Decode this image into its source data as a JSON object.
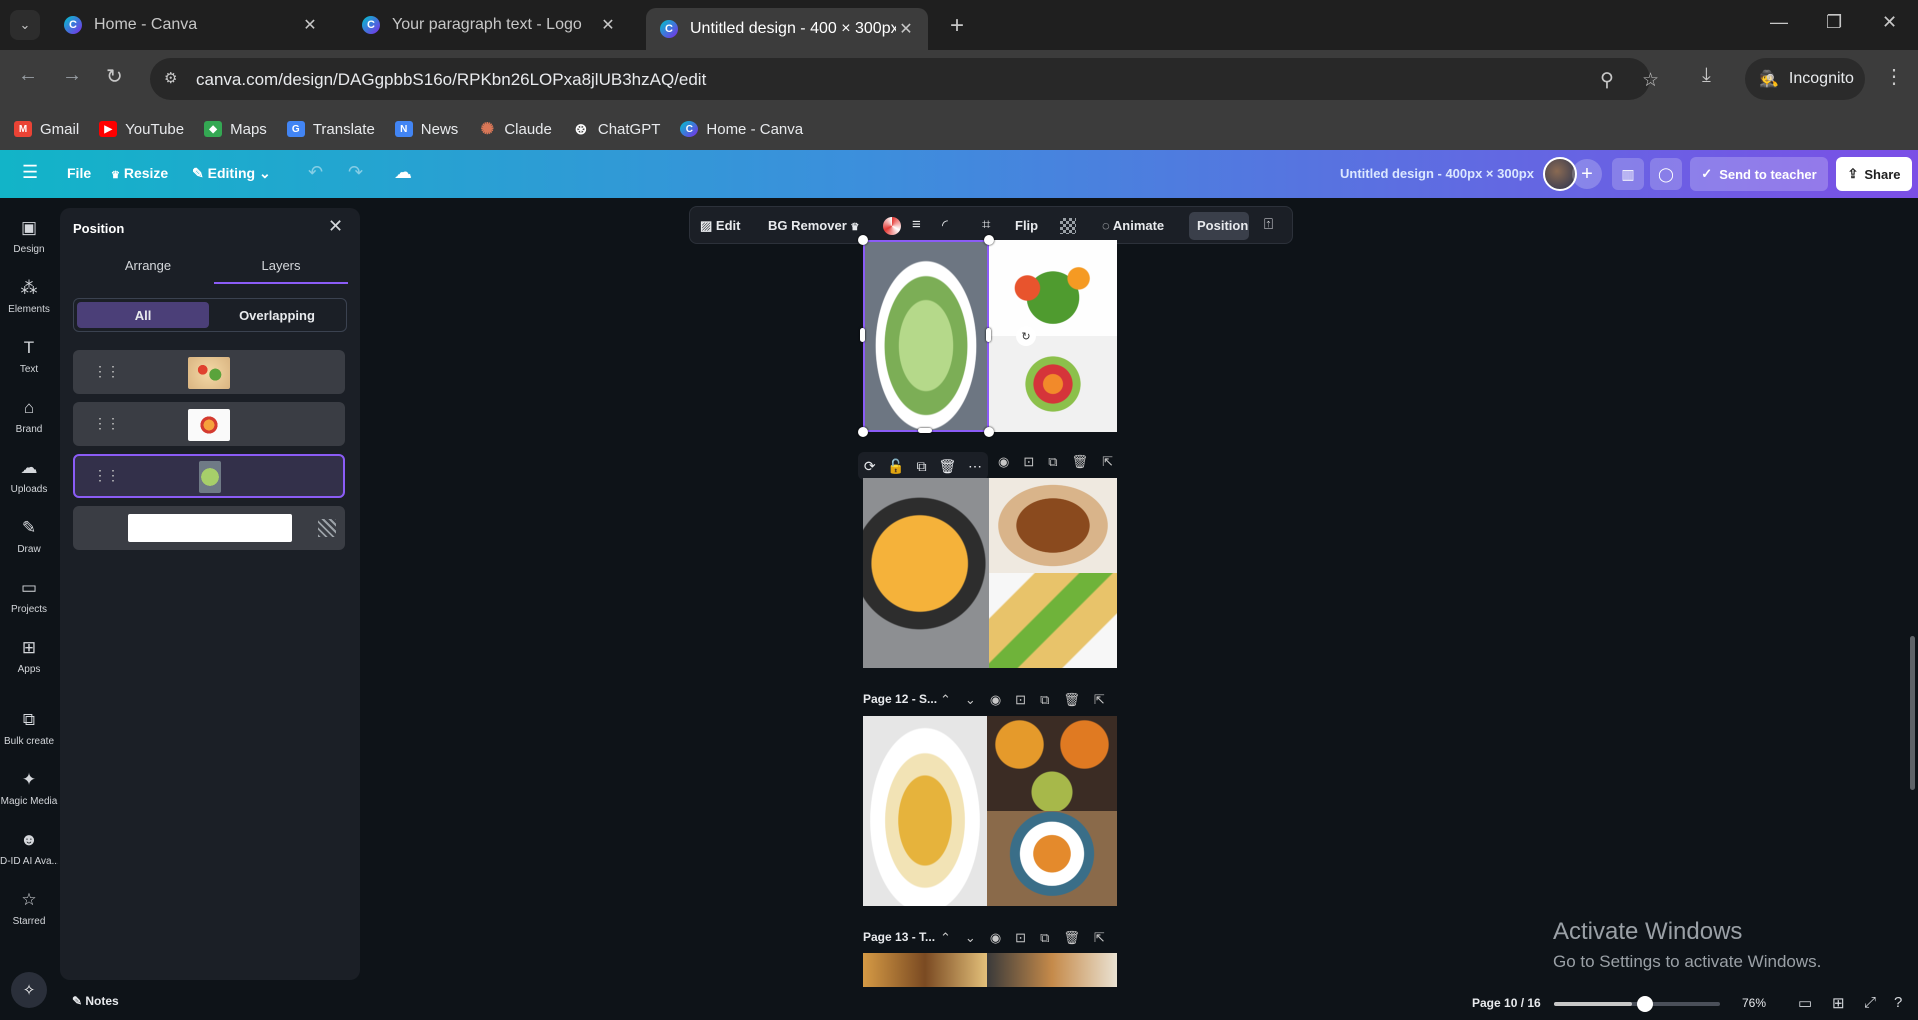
{
  "browser": {
    "tabs": [
      {
        "title": "Home - Canva",
        "active": false
      },
      {
        "title": "Your paragraph text - Logo",
        "active": false
      },
      {
        "title": "Untitled design - 400 × 300px",
        "active": true
      }
    ],
    "url": "canva.com/design/DAGgpbbS16o/RPKbn26LOPxa8jlUB3hzAQ/edit",
    "incognito_label": "Incognito",
    "bookmarks": [
      {
        "label": "Gmail",
        "icon": "gmail-icon",
        "color": "#ea4335"
      },
      {
        "label": "YouTube",
        "icon": "youtube-icon",
        "color": "#ff0000"
      },
      {
        "label": "Maps",
        "icon": "maps-icon",
        "color": "#34a853"
      },
      {
        "label": "Translate",
        "icon": "translate-icon",
        "color": "#4285f4"
      },
      {
        "label": "News",
        "icon": "news-icon",
        "color": "#4285f4"
      },
      {
        "label": "Claude",
        "icon": "claude-icon",
        "color": "#d97757"
      },
      {
        "label": "ChatGPT",
        "icon": "chatgpt-icon",
        "color": "#ffffff"
      },
      {
        "label": "Home - Canva",
        "icon": "canva-icon",
        "color": "#00c4cc"
      }
    ]
  },
  "canva_bar": {
    "file": "File",
    "resize": "Resize",
    "editing": "Editing",
    "design_title": "Untitled design - 400px × 300px",
    "send_to_teacher": "Send to teacher",
    "share": "Share"
  },
  "rail": [
    {
      "label": "Design",
      "icon": "design-icon"
    },
    {
      "label": "Elements",
      "icon": "elements-icon"
    },
    {
      "label": "Text",
      "icon": "text-icon"
    },
    {
      "label": "Brand",
      "icon": "brand-icon"
    },
    {
      "label": "Uploads",
      "icon": "uploads-icon"
    },
    {
      "label": "Draw",
      "icon": "draw-icon"
    },
    {
      "label": "Projects",
      "icon": "projects-icon"
    },
    {
      "label": "Apps",
      "icon": "apps-icon"
    },
    {
      "label": "Bulk create",
      "icon": "bulk-create-icon"
    },
    {
      "label": "Magic Media",
      "icon": "magic-media-icon"
    },
    {
      "label": "D-ID AI Ava...",
      "icon": "did-avatar-icon"
    },
    {
      "label": "Starred",
      "icon": "star-icon"
    }
  ],
  "panel": {
    "title": "Position",
    "tabs": [
      "Arrange",
      "Layers"
    ],
    "active_tab": "Layers",
    "filters": [
      "All",
      "Overlapping"
    ],
    "active_filter": "All",
    "notes": "Notes"
  },
  "toolbar": {
    "edit": "Edit",
    "bg_remover": "BG Remover",
    "flip": "Flip",
    "animate": "Animate",
    "position": "Position"
  },
  "pages": [
    {
      "label": "Page 12 - S..."
    },
    {
      "label": "Page 13 - T..."
    }
  ],
  "watermark": {
    "line1": "Activate Windows",
    "line2": "Go to Settings to activate Windows."
  },
  "footer": {
    "page_count": "Page 10 / 16",
    "zoom": "76%",
    "zoom_fraction": 0.76
  },
  "colors": {
    "accent": "#8b5cf6",
    "canva_gradient_start": "#12b4c8",
    "canva_gradient_end": "#7b4fe6"
  }
}
